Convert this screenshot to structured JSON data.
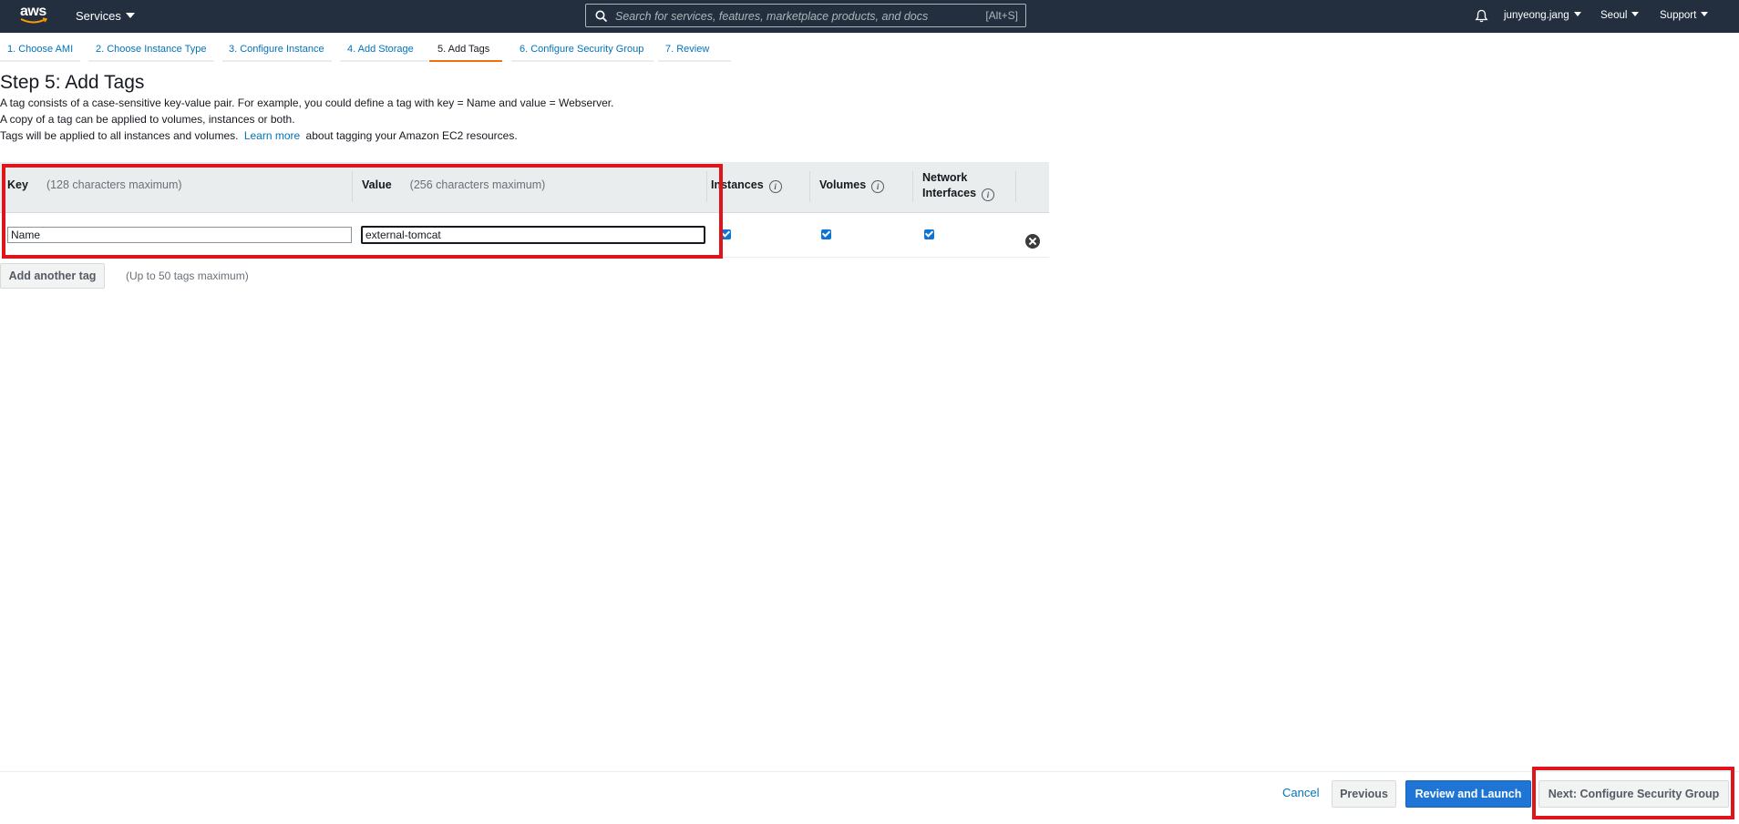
{
  "topnav": {
    "logo_text": "aws",
    "services_label": "Services",
    "search_placeholder": "Search for services, features, marketplace products, and docs",
    "search_shortcut": "[Alt+S]",
    "user_label": "junyeong.jang",
    "region_label": "Seoul",
    "support_label": "Support"
  },
  "steps": [
    {
      "label": "1. Choose AMI"
    },
    {
      "label": "2. Choose Instance Type"
    },
    {
      "label": "3. Configure Instance"
    },
    {
      "label": "4. Add Storage"
    },
    {
      "label": "5. Add Tags",
      "active": true
    },
    {
      "label": "6. Configure Security Group"
    },
    {
      "label": "7. Review"
    }
  ],
  "page": {
    "title": "Step 5: Add Tags",
    "desc_line1": "A tag consists of a case-sensitive key-value pair. For example, you could define a tag with key = Name and value = Webserver.",
    "desc_line2": "A copy of a tag can be applied to volumes, instances or both.",
    "desc_line3_pre": "Tags will be applied to all instances and volumes.",
    "learn_more": "Learn more",
    "desc_line3_post": "about tagging your Amazon EC2 resources."
  },
  "table": {
    "headers": {
      "key": "Key",
      "key_hint": "(128 characters maximum)",
      "value": "Value",
      "value_hint": "(256 characters maximum)",
      "instances": "Instances",
      "volumes": "Volumes",
      "network_line1": "Network",
      "network_line2": "Interfaces"
    },
    "rows": [
      {
        "key": "Name",
        "value": "external-tomcat",
        "instances": true,
        "volumes": true,
        "network_interfaces": true
      }
    ]
  },
  "add_tag": {
    "label": "Add another tag",
    "hint": "(Up to 50 tags maximum)"
  },
  "footer": {
    "cancel": "Cancel",
    "previous": "Previous",
    "review_launch": "Review and Launch",
    "next": "Next: Configure Security Group"
  },
  "colors": {
    "nav_bg": "#232f3e",
    "link": "#0073bb",
    "active_step": "#ec7211",
    "primary_button": "#1e75d5",
    "highlight_box": "#e0151c"
  }
}
